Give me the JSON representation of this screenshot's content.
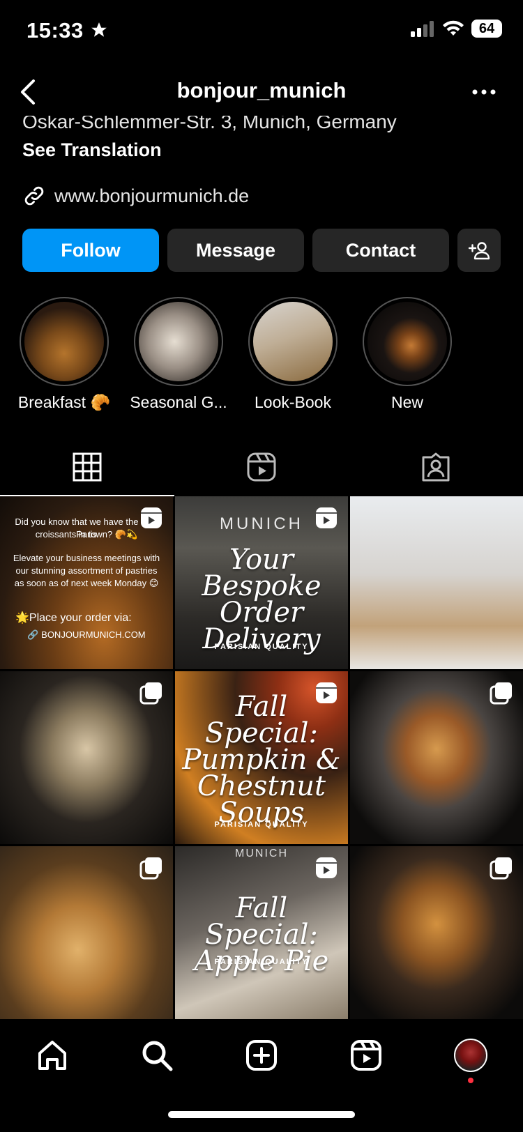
{
  "status": {
    "time": "15:33",
    "battery": "64"
  },
  "header": {
    "username": "bonjour_munich"
  },
  "bio": {
    "address_line": "Oskar-Schlemmer-Str. 3, Munich, Germany",
    "see_translation": "See Translation",
    "website": "www.bonjourmunich.de"
  },
  "actions": {
    "follow": "Follow",
    "message": "Message",
    "contact": "Contact"
  },
  "highlights": [
    {
      "label": "Breakfast 🥐"
    },
    {
      "label": "Seasonal G..."
    },
    {
      "label": "Look-Book"
    },
    {
      "label": "New"
    }
  ],
  "posts": {
    "p1": {
      "line1": "Did you know that we have the best Paris",
      "line2": "croissants in town? 🥐💫",
      "line3": "Elevate your business meetings with our stunning assortment of pastries as soon as of next week Monday 😊",
      "order": "🌟Place your order via:",
      "url": "🔗 BONJOURMUNICH.COM"
    },
    "p2": {
      "title": "Your Bespoke Order Delivery",
      "tagline": "PARISIAN QUALITY",
      "sign": "MUNICH"
    },
    "p5": {
      "title": "Fall Special: Pumpkin & Chestnut Soups",
      "tagline": "PARISIAN QUALITY"
    },
    "p8": {
      "title": "Fall Special: Apple Pie",
      "tagline": "PARISIAN QUALITY",
      "sign": "MUNICH"
    }
  },
  "colors": {
    "accent": "#0095f6",
    "button_dark": "#262626",
    "notification": "#ff3040"
  }
}
